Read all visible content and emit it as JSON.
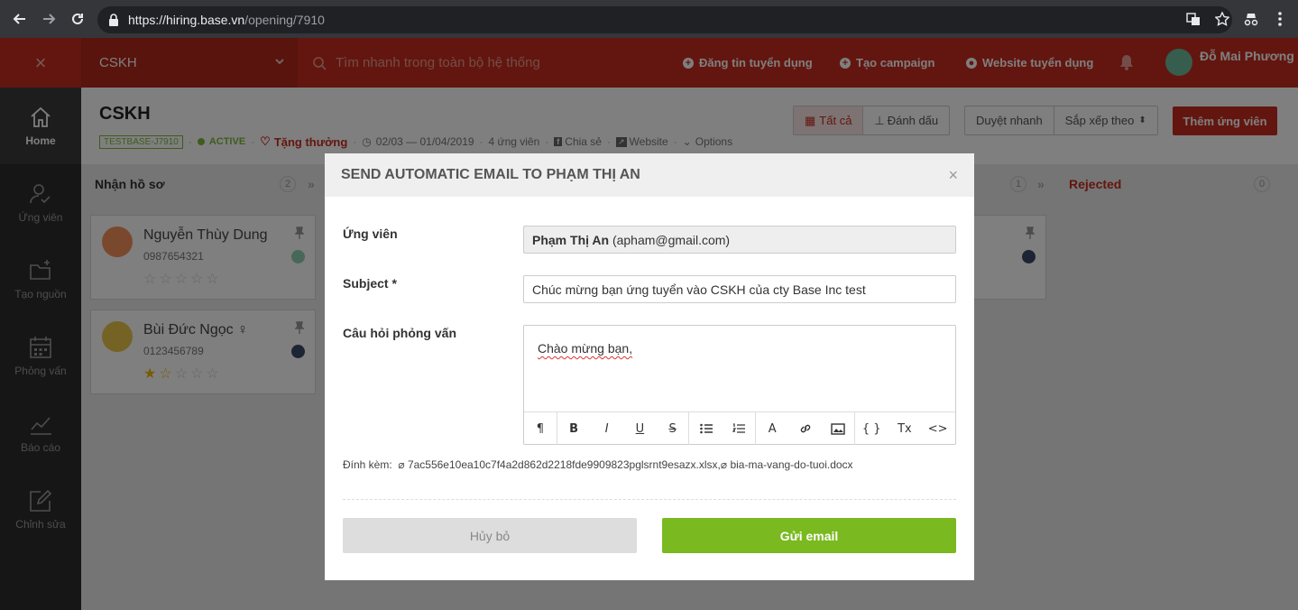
{
  "browser": {
    "url_host": "https://hiring.base.vn",
    "url_path": "/opening/7910"
  },
  "header": {
    "close_symbol": "×",
    "selector": "CSKH",
    "search_placeholder": "Tìm nhanh trong toàn bộ hệ thống",
    "links": [
      "Đăng tin tuyển dụng",
      "Tạo campaign",
      "Website tuyển dụng"
    ],
    "user_name": "Đỗ Mai Phương"
  },
  "sidebar": {
    "items": [
      {
        "label": "Home",
        "icon": "home-icon"
      },
      {
        "label": "Ứng viên",
        "icon": "user-check-icon"
      },
      {
        "label": "Tạo nguồn",
        "icon": "folder-plus-icon"
      },
      {
        "label": "Phỏng vấn",
        "icon": "calendar-icon"
      },
      {
        "label": "Báo cáo",
        "icon": "chart-icon"
      },
      {
        "label": "Chỉnh sửa",
        "icon": "edit-icon"
      }
    ]
  },
  "page": {
    "title": "CSKH",
    "code": "TESTBASE-J7910",
    "status": "ACTIVE",
    "reward": "Tặng thưởng",
    "dates": "02/03 — 01/04/2019",
    "candidates": "4 ứng viên",
    "share": "Chia sẻ",
    "website": "Website",
    "options": "Options",
    "filter_all": "Tất cả",
    "filter_marked": "Đánh dấu",
    "quick_review": "Duyệt nhanh",
    "sort": "Sắp xếp theo",
    "add_candidate": "Thêm ứng viên"
  },
  "board": {
    "columns": [
      {
        "name": "Nhận hồ sơ",
        "count": "2"
      },
      {
        "name": "",
        "count": "1"
      },
      {
        "name": "Rejected",
        "count": "0"
      }
    ],
    "cards": [
      {
        "name": "Nguyễn Thùy Dung",
        "phone": "0987654321",
        "rating": 0,
        "avatar_color": "#f4925a"
      },
      {
        "name": "Bùi Đức Ngọc ♀",
        "phone": "0123456789",
        "rating": 1.5,
        "avatar_color": "#e8c64a"
      }
    ]
  },
  "modal": {
    "title": "SEND AUTOMATIC EMAIL TO PHẠM THỊ AN",
    "close": "×",
    "candidate_label": "Ứng viên",
    "candidate_name": "Phạm Thị An",
    "candidate_email": "(apham@gmail.com)",
    "subject_label": "Subject *",
    "subject_value": "Chúc mừng bạn ứng tuyển vào CSKH của cty Base Inc test",
    "question_label": "Câu hỏi phỏng vấn",
    "editor_text": "Chào mừng bạn,",
    "toolbar": [
      "¶",
      "B",
      "I",
      "U",
      "S",
      "ul",
      "ol",
      "A",
      "link",
      "image",
      "{ }",
      "Tx",
      "<>"
    ],
    "attach_label": "Đính kèm:",
    "attachments": [
      "7ac556e10ea10c7f4a2d862d2218fde9909823pglsrnt9esazx.xlsx,",
      "bia-ma-vang-do-tuoi.docx"
    ],
    "cancel": "Hủy bỏ",
    "send": "Gửi email"
  }
}
